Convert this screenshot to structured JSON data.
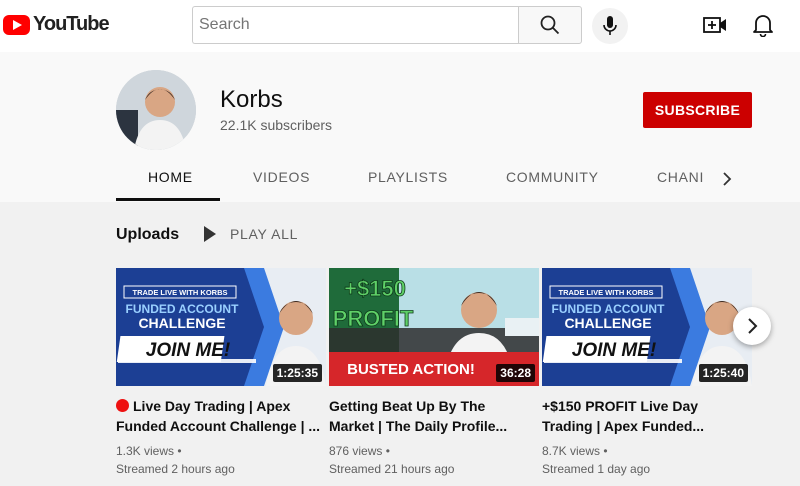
{
  "app": {
    "logo_text": "YouTube"
  },
  "search": {
    "placeholder": "Search"
  },
  "icons": {
    "logo": "youtube-play-icon",
    "search": "search-icon",
    "mic": "microphone-icon",
    "create": "video-create-icon",
    "notifications": "bell-icon",
    "tabs_next": "chevron-right-icon",
    "play_all": "play-icon",
    "carousel_next": "chevron-right-icon"
  },
  "channel": {
    "name": "Korbs",
    "subscribers": "22.1K subscribers",
    "subscribe_label": "SUBSCRIBE"
  },
  "tabs": [
    {
      "label": "HOME",
      "active": true
    },
    {
      "label": "VIDEOS"
    },
    {
      "label": "PLAYLISTS"
    },
    {
      "label": "COMMUNITY"
    },
    {
      "label": "CHANNELS",
      "visible_text": "CHANI"
    }
  ],
  "uploads": {
    "title": "Uploads",
    "play_all_label": "PLAY ALL",
    "videos": [
      {
        "title": "Live Day Trading | Apex Funded Account Challenge | ...",
        "duration": "1:25:35",
        "views": "1.3K views",
        "streamed": "Streamed 2 hours ago",
        "live_indicator": true,
        "thumb": {
          "banner": "TRADE LIVE WITH KORBS",
          "line1": "FUNDED ACCOUNT",
          "line2": "CHALLENGE",
          "cta": "JOIN ME!"
        }
      },
      {
        "title": "Getting Beat Up By The Market | The Daily Profile...",
        "duration": "36:28",
        "views": "876 views",
        "streamed": "Streamed 21 hours ago",
        "thumb": {
          "profit": "+$150",
          "profit_word": "PROFIT",
          "caption": "BUSTED ACTION!"
        }
      },
      {
        "title": "+$150 PROFIT Live Day Trading | Apex Funded...",
        "duration": "1:25:40",
        "views": "8.7K views",
        "streamed": "Streamed 1 day ago",
        "thumb": {
          "banner": "TRADE LIVE WITH KORBS",
          "line1": "FUNDED ACCOUNT",
          "line2": "CHALLENGE",
          "cta": "JOIN ME!"
        }
      }
    ]
  },
  "colors": {
    "brand_red": "#ff0000",
    "subscribe_red": "#cc0000",
    "thumb_blue": "#1c3f94",
    "thumb_green": "#5fd068"
  }
}
